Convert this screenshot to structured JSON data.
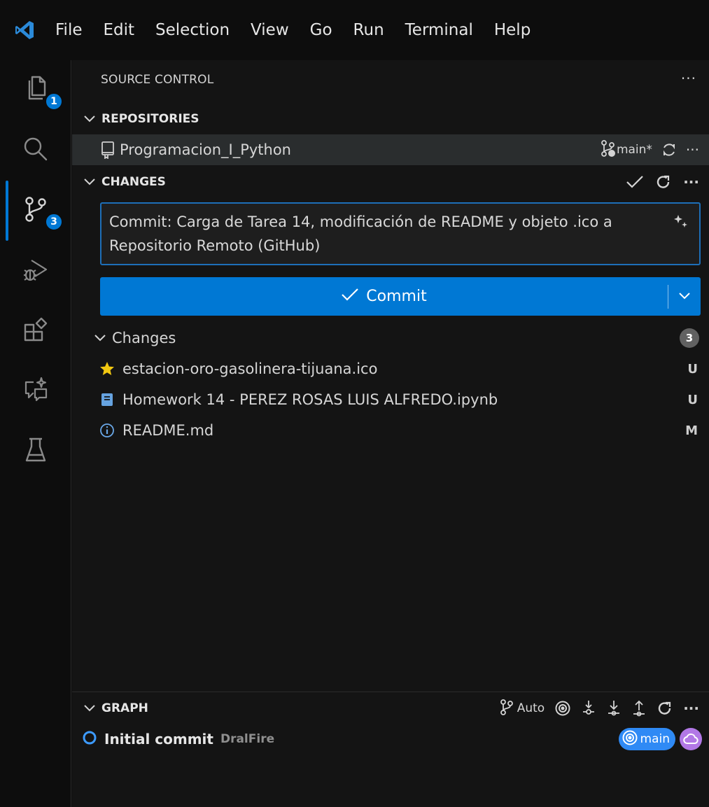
{
  "menu": [
    "File",
    "Edit",
    "Selection",
    "View",
    "Go",
    "Run",
    "Terminal",
    "Help"
  ],
  "activity": {
    "explorer_badge": "1",
    "scm_badge": "3",
    "accent": "#0078d4"
  },
  "panel": {
    "title": "SOURCE CONTROL",
    "more": "···"
  },
  "repositories": {
    "header": "REPOSITORIES",
    "repo_name": "Programacion_I_Python",
    "branch": "main*",
    "more": "···"
  },
  "changes_section": {
    "header": "CHANGES",
    "more": "···"
  },
  "commit": {
    "message": "Commit: Carga de Tarea 14, modificación de README y objeto .ico a Repositorio Remoto (GitHub)",
    "button_label": "Commit"
  },
  "changes_group": {
    "label": "Changes",
    "count": "3"
  },
  "files": [
    {
      "name": "estacion-oro-gasolinera-tijuana.ico",
      "status": "U",
      "icon": "star-icon"
    },
    {
      "name": "Homework 14 - PEREZ ROSAS LUIS ALFREDO.ipynb",
      "status": "U",
      "icon": "notebook-icon"
    },
    {
      "name": "README.md",
      "status": "M",
      "icon": "info-icon"
    }
  ],
  "graph": {
    "header": "GRAPH",
    "auto": "Auto",
    "more": "···",
    "commit_message": "Initial commit",
    "author": "DralFire",
    "branch_tag": "main"
  }
}
